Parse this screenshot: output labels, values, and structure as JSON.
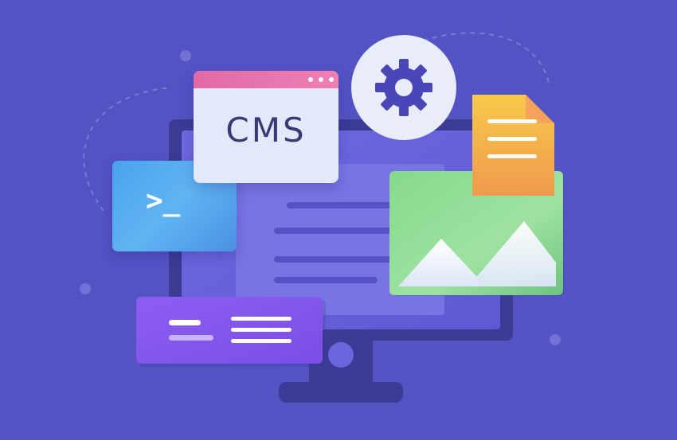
{
  "cms_window": {
    "label": "CMS"
  },
  "terminal": {
    "prompt": ">_"
  },
  "icons": [
    "gear-icon",
    "document-icon",
    "image-icon",
    "terminal-icon",
    "monitor-icon"
  ],
  "colors": {
    "background": "#5353c4",
    "monitor_frame": "#3b3a94",
    "monitor_screen": "#6a66dd",
    "cms_titlebar": "#e06aa6",
    "terminal_card": "#4aa2ec",
    "image_card": "#7fd08e",
    "document": "#f3b34b",
    "text_card": "#8b5cf0",
    "gear": "#4b46b8"
  }
}
